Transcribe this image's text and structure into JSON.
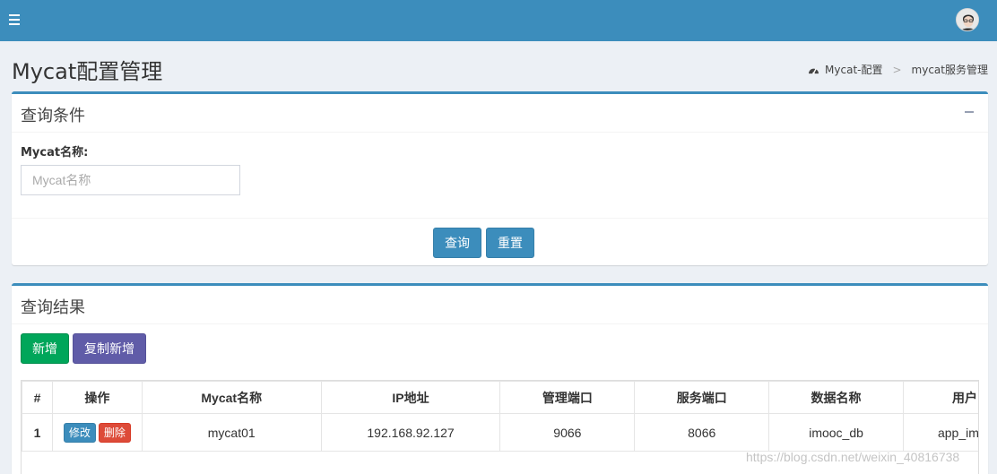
{
  "header": {
    "avatar_alt": "user avatar"
  },
  "page": {
    "title": "Mycat配置管理"
  },
  "breadcrumb": {
    "items": [
      "Mycat-配置",
      "mycat服务管理"
    ],
    "separator": ">"
  },
  "query_box": {
    "title": "查询条件",
    "field_label": "Mycat名称:",
    "field_placeholder": "Mycat名称",
    "field_value": "",
    "query_button": "查询",
    "reset_button": "重置"
  },
  "result_box": {
    "title": "查询结果",
    "add_button": "新增",
    "copy_add_button": "复制新增",
    "table": {
      "columns": [
        "#",
        "操作",
        "Mycat名称",
        "IP地址",
        "管理端口",
        "服务端口",
        "数据名称",
        "用户"
      ],
      "rows": [
        {
          "index": "1",
          "edit": "修改",
          "delete": "删除",
          "name": "mycat01",
          "ip": "192.168.92.127",
          "mgmt_port": "9066",
          "service_port": "8066",
          "db_name": "imooc_db",
          "user": "app_im"
        }
      ]
    }
  },
  "watermark": "https://blog.csdn.net/weixin_40816738",
  "colors": {
    "primary": "#3c8dbc",
    "success": "#00a65a",
    "purple": "#605ca8",
    "danger": "#dd4b39",
    "background": "#ecf0f5"
  },
  "icons": [
    "menu-icon",
    "dashboard-icon",
    "collapse-icon"
  ]
}
